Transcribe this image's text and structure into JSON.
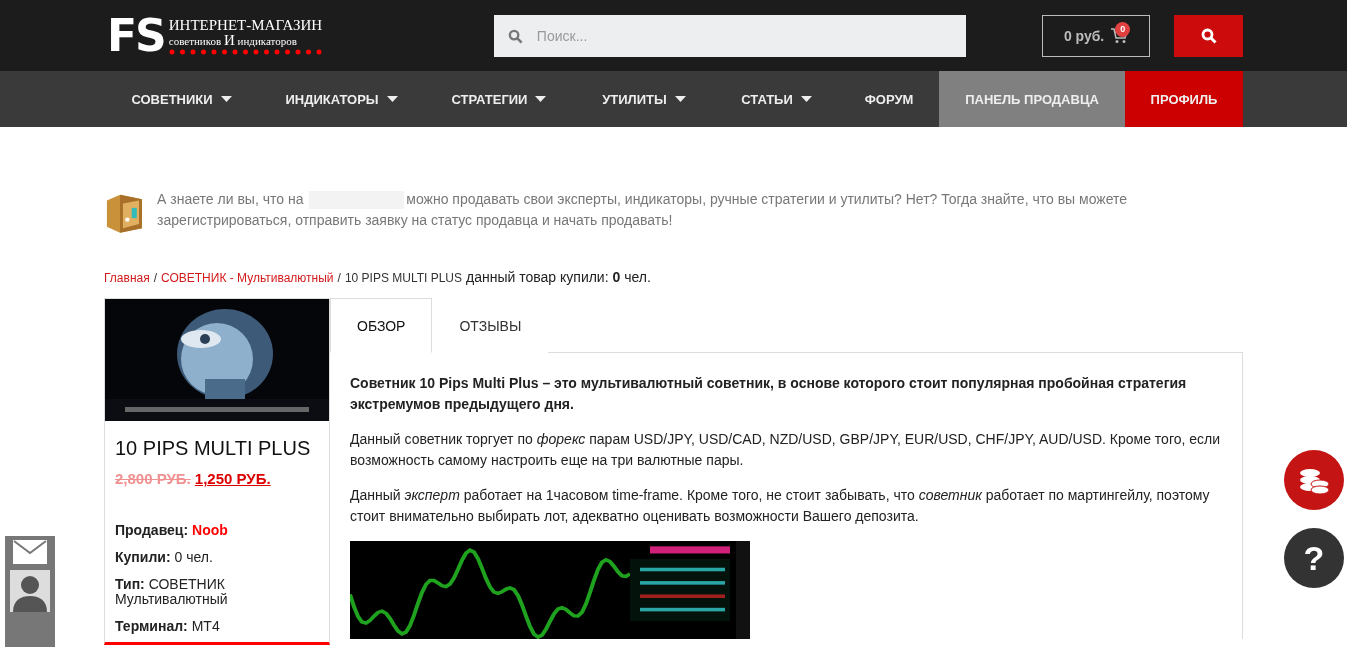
{
  "header": {
    "logo": {
      "mark": "FS",
      "line1": "ИНТЕРНЕТ-МАГАЗИН",
      "line2_a": "советников",
      "line2_b": "И",
      "line2_c": "индикаторов"
    },
    "search": {
      "placeholder": "Поиск..."
    },
    "cart": {
      "total": "0 руб.",
      "count": "0"
    }
  },
  "nav": [
    {
      "label": "СОВЕТНИКИ",
      "caret": true,
      "kind": "plain"
    },
    {
      "label": "ИНДИКАТОРЫ",
      "caret": true,
      "kind": "plain"
    },
    {
      "label": "СТРАТЕГИИ",
      "caret": true,
      "kind": "plain"
    },
    {
      "label": "УТИЛИТЫ",
      "caret": true,
      "kind": "plain"
    },
    {
      "label": "СТАТЬИ",
      "caret": true,
      "kind": "plain"
    },
    {
      "label": "ФОРУМ",
      "caret": false,
      "kind": "plain"
    },
    {
      "label": "ПАНЕЛЬ ПРОДАВЦА",
      "caret": false,
      "kind": "seller"
    },
    {
      "label": "ПРОФИЛЬ",
      "caret": false,
      "kind": "profile"
    }
  ],
  "notice": {
    "before": "А знаете ли вы, что на",
    "after": "можно продавать свои эксперты, индикаторы, ручные стратегии и утилиты? Нет? Тогда знайте, что вы можете зарегистрироваться, отправить заявку на статус продавца и начать продавать!"
  },
  "breadcrumb": {
    "separator": "/",
    "links": [
      "Главная",
      "СОВЕТНИК - Мультивалютный"
    ],
    "current": "10 PIPS MULTI PLUS",
    "bought": "данный товар купили: **0** чел."
  },
  "product": {
    "title": "10 PIPS MULTI PLUS",
    "old_price": "2,800 РУБ.",
    "price": "1,250 РУБ.",
    "info": [
      {
        "label": "Продавец:",
        "value": "Noob",
        "link": true
      },
      {
        "label": "Купили:",
        "value": "0 чел.",
        "link": false
      },
      {
        "label": "Тип:",
        "value": "СОВЕТНИК Мультивалютный",
        "link": false
      },
      {
        "label": "Терминал:",
        "value": "MT4",
        "link": false
      }
    ]
  },
  "tabs": [
    {
      "label": "ОБЗОР",
      "selected": true
    },
    {
      "label": "ОТЗЫВЫ",
      "selected": false
    }
  ],
  "description": [
    {
      "kind": "lead",
      "text": "Советник 10 Pips Multi Plus – это мультивалютный советник, в основе которого стоит популярная пробойная стратегия экстремумов предыдущего дня."
    },
    {
      "kind": "text",
      "text": "Данный советник торгует по *форекс* парам USD/JPY, USD/CAD, NZD/USD, GBP/JPY, EUR/USD, CHF/JPY, AUD/USD. Кроме того, если возможность самому настроить еще на три валютные пары."
    },
    {
      "kind": "text",
      "text": "Данный *эксперт* работает на 1часовом time-frame. Кроме того, не стоит забывать, что *советник* работает по мартингейлу, поэтому стоит внимательно выбирать лот, адекватно оценивать возможности Вашего депозита."
    },
    {
      "kind": "picture"
    }
  ],
  "floating": {
    "help": "?"
  }
}
